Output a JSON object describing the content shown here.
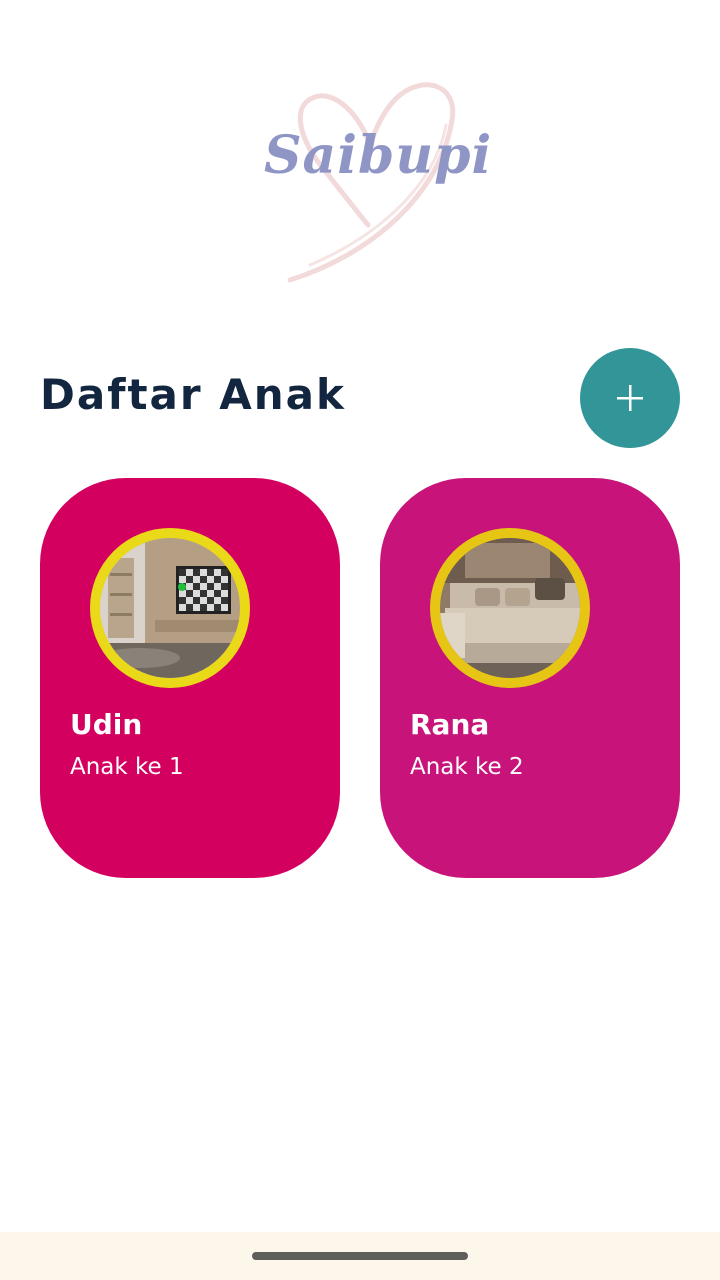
{
  "app": {
    "logo_text": "Saibupi"
  },
  "header": {
    "title": "Daftar Anak",
    "add_icon": "plus-icon"
  },
  "children": [
    {
      "name": "Udin",
      "order": "Anak ke 1",
      "card_color": "#d4005f",
      "photo": "living-room-tv-photo"
    },
    {
      "name": "Rana",
      "order": "Anak ke 2",
      "card_color": "#c8147a",
      "photo": "sofa-room-photo"
    }
  ],
  "colors": {
    "title": "#13263f",
    "add_button": "#329598",
    "avatar_ring": "#ead918",
    "logo_text": "#8f96c6",
    "logo_heart": "#f3dada",
    "nav_bar": "#fdf6ea"
  }
}
